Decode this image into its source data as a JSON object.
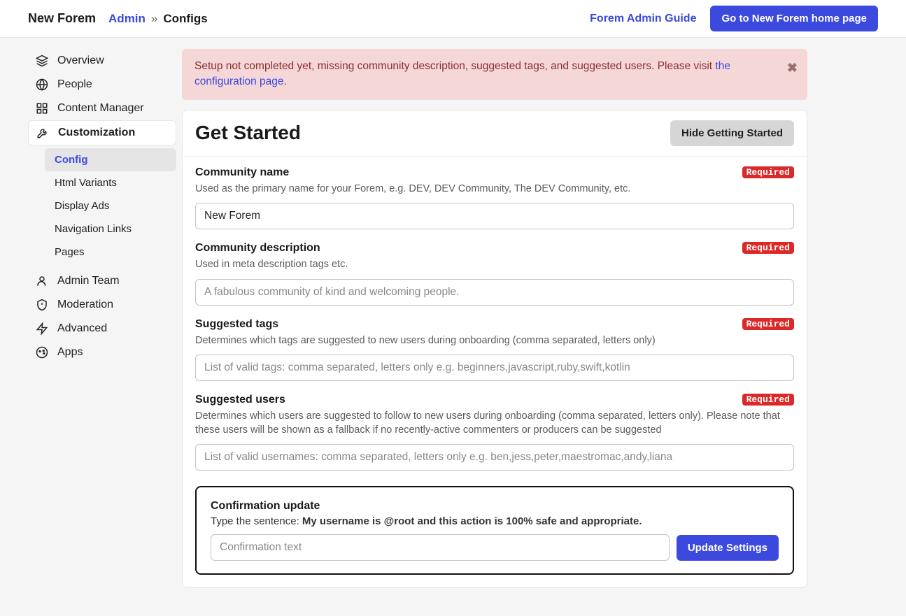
{
  "header": {
    "site_name": "New Forem",
    "breadcrumb_admin": "Admin",
    "breadcrumb_sep": "»",
    "breadcrumb_current": "Configs",
    "guide_link": "Forem Admin Guide",
    "goto_button": "Go to New Forem home page"
  },
  "sidebar": {
    "items": [
      {
        "label": "Overview"
      },
      {
        "label": "People"
      },
      {
        "label": "Content Manager"
      },
      {
        "label": "Customization"
      },
      {
        "label": "Admin Team"
      },
      {
        "label": "Moderation"
      },
      {
        "label": "Advanced"
      },
      {
        "label": "Apps"
      }
    ],
    "sub": [
      {
        "label": "Config"
      },
      {
        "label": "Html Variants"
      },
      {
        "label": "Display Ads"
      },
      {
        "label": "Navigation Links"
      },
      {
        "label": "Pages"
      }
    ]
  },
  "alert": {
    "text_before": "Setup not completed yet, missing community description, suggested tags, and suggested users. Please visit ",
    "link_text": "the configuration page",
    "text_after": "."
  },
  "card": {
    "title": "Get Started",
    "hide_button": "Hide Getting Started"
  },
  "badges": {
    "required": "Required"
  },
  "fields": {
    "name": {
      "label": "Community name",
      "help": "Used as the primary name for your Forem, e.g. DEV, DEV Community, The DEV Community, etc.",
      "value": "New Forem"
    },
    "desc": {
      "label": "Community description",
      "help": "Used in meta description tags etc.",
      "placeholder": "A fabulous community of kind and welcoming people."
    },
    "tags": {
      "label": "Suggested tags",
      "help": "Determines which tags are suggested to new users during onboarding (comma separated, letters only)",
      "placeholder": "List of valid tags: comma separated, letters only e.g. beginners,javascript,ruby,swift,kotlin"
    },
    "users": {
      "label": "Suggested users",
      "help": "Determines which users are suggested to follow to new users during onboarding (comma separated, letters only). Please note that these users will be shown as a fallback if no recently-active commenters or producers can be suggested",
      "placeholder": "List of valid usernames: comma separated, letters only e.g. ben,jess,peter,maestromac,andy,liana"
    }
  },
  "confirm": {
    "title": "Confirmation update",
    "help_prefix": "Type the sentence: ",
    "help_bold": "My username is @root and this action is 100% safe and appropriate.",
    "placeholder": "Confirmation text",
    "button": "Update Settings"
  }
}
